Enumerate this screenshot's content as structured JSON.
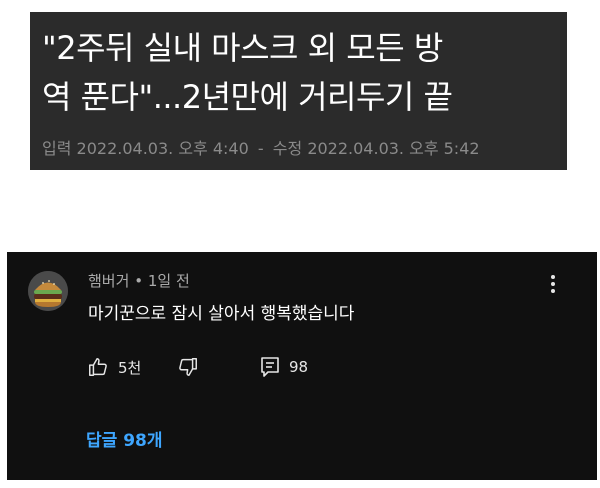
{
  "article": {
    "title_line1": "\"2주뒤 실내 마스크 외 모든 방",
    "title_line2": "역 푼다\"...2년만에 거리두기 끝",
    "input_label": "입력",
    "input_time": "2022.04.03. 오후 4:40",
    "separator": "-",
    "edit_label": "수정",
    "edit_time": "2022.04.03. 오후 5:42"
  },
  "comment": {
    "author": "햄버거",
    "dot": "•",
    "age": "1일 전",
    "text": "마기꾼으로 잠시 살아서 행복했습니다",
    "likes": "5천",
    "reply_count": "98",
    "replies_link": "답글 98개",
    "link_color": "#3ea6ff"
  }
}
